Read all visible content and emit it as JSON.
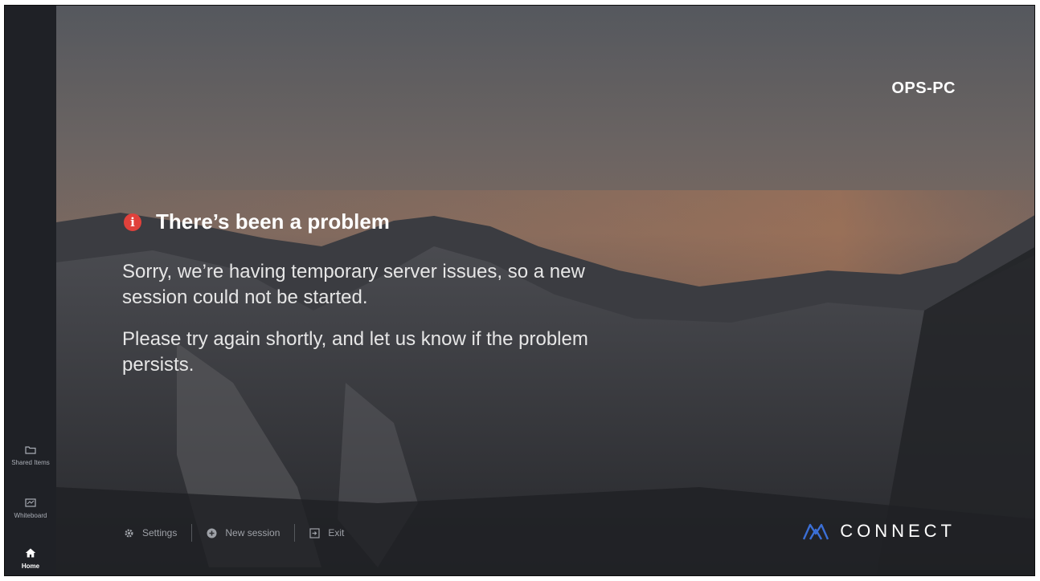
{
  "sidebar": {
    "items": [
      {
        "label": "Shared Items",
        "icon": "folder-icon"
      },
      {
        "label": "Whiteboard",
        "icon": "whiteboard-icon"
      },
      {
        "label": "Home",
        "icon": "home-icon",
        "active": true
      }
    ]
  },
  "device_name": "OPS-PC",
  "error": {
    "icon": "info-alert-icon",
    "icon_glyph": "i",
    "title": "There’s been a problem",
    "message_1": "Sorry, we’re having temporary server issues, so a new session could not be started.",
    "message_2": "Please try again shortly, and let us know if the problem persists."
  },
  "footer": {
    "settings_label": "Settings",
    "new_session_label": "New session",
    "exit_label": "Exit"
  },
  "brand": {
    "name": "CONNECT",
    "logo": "connect-logo",
    "logo_color": "#3b6fd6"
  },
  "colors": {
    "alert": "#e0413b",
    "sidebar": "#1f2126"
  }
}
